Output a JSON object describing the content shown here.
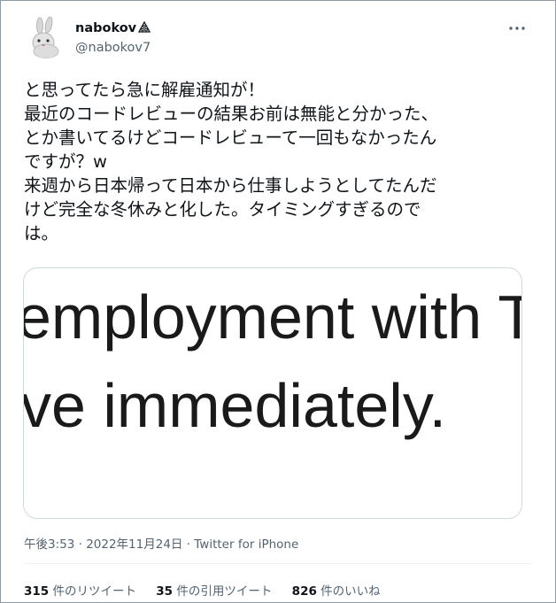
{
  "user": {
    "display_name": "nabokov",
    "handle": "@nabokov7"
  },
  "icons": {
    "lock": "triangle-lock-icon",
    "more": "more-dots-icon",
    "avatar": "rabbit-avatar"
  },
  "tweet": {
    "lines": [
      "と思ってたら急に解雇通知が！",
      "最近のコードレビューの結果お前は無能と分かった、",
      "とか書いてるけどコードレビューて一回もなかったん",
      "ですが？w",
      "来週から日本帰って日本から仕事しようとしてたんだ",
      "けど完全な冬休みと化した。タイミングすぎるので",
      "は。"
    ]
  },
  "media": {
    "line1": "employment with T",
    "line2": "ve immediately."
  },
  "meta": {
    "time": "午後3:53",
    "separator1": " · ",
    "date": "2022年11月24日",
    "separator2": " · ",
    "source": "Twitter for iPhone"
  },
  "stats": {
    "retweets_count": "315",
    "retweets_label": " 件のリツイート",
    "quotes_count": "35",
    "quotes_label": " 件の引用ツイート",
    "likes_count": "826",
    "likes_label": " 件のいいね"
  },
  "colors": {
    "text": "#0f1419",
    "secondary": "#536471",
    "border": "#cfd9de",
    "frame": "#8e9aa5"
  }
}
